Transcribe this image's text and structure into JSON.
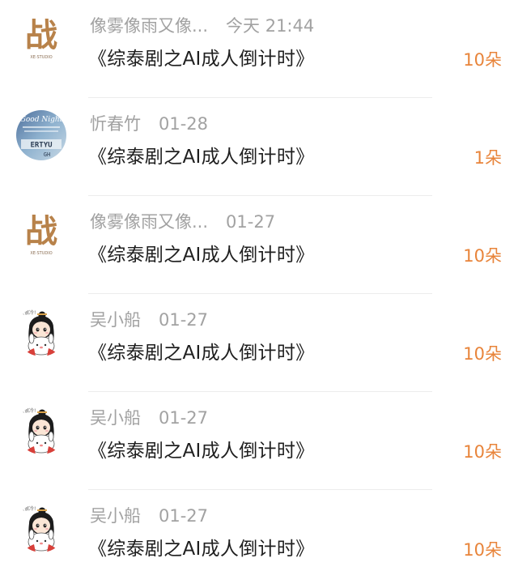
{
  "colors": {
    "gift_count": "#e8843a",
    "meta_text": "#a2a2a2",
    "title_text": "#1f1f1f",
    "divider": "#ececec"
  },
  "icons": {
    "calligraphy_avatar": "zhan-calligraphy-logo-icon",
    "goodnight_avatar": "good-night-keyboard-icon",
    "cartoon_avatar": "cartoon-girl-with-bunny-icon"
  },
  "avatar_texts": {
    "calligraphy_char": "战",
    "calligraphy_caption": "XE·STUDIO",
    "goodnight_heading": "Good Night",
    "goodnight_keys": "ERTYU",
    "goodnight_keys2": "GH",
    "cartoon_speech": "天很冷!"
  },
  "rows": [
    {
      "name": "像雾像雨又像...",
      "time": "今天 21:44",
      "title": "《综泰剧之AI成人倒计时》",
      "gift": "10朵"
    },
    {
      "name": "忻春竹",
      "time": "01-28",
      "title": "《综泰剧之AI成人倒计时》",
      "gift": "1朵"
    },
    {
      "name": "像雾像雨又像...",
      "time": "01-27",
      "title": "《综泰剧之AI成人倒计时》",
      "gift": "10朵"
    },
    {
      "name": "吴小船",
      "time": "01-27",
      "title": "《综泰剧之AI成人倒计时》",
      "gift": "10朵"
    },
    {
      "name": "吴小船",
      "time": "01-27",
      "title": "《综泰剧之AI成人倒计时》",
      "gift": "10朵"
    },
    {
      "name": "吴小船",
      "time": "01-27",
      "title": "《综泰剧之AI成人倒计时》",
      "gift": "10朵"
    }
  ]
}
